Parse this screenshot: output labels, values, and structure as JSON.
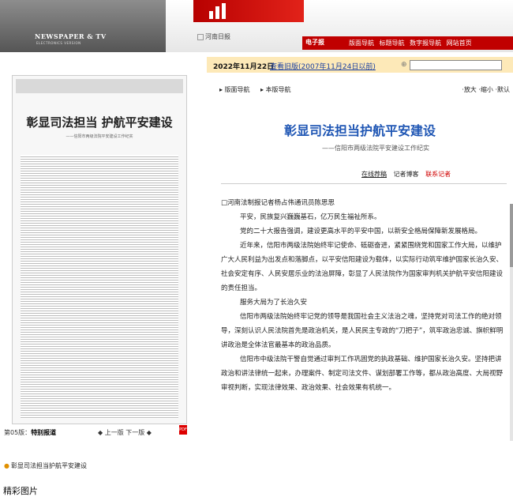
{
  "header": {
    "logo_title": "NEWSPAPER & TV",
    "logo_subtitle": "ELECTRONICS VERSION",
    "logo_alt": "河南日报",
    "nav_title": "电子报",
    "nav_items": [
      "版面导航",
      "标题导航",
      "数字报导航",
      "网站首页"
    ],
    "accent": "#c00000"
  },
  "left": {
    "thumbnail": {
      "headline": "彰显司法担当 护航平安建设",
      "subhead": "——信阳市两级法院平安建设工作纪实"
    },
    "edition_prefix": "第05版：",
    "edition_name": "特别报道",
    "prev_page": "上一版",
    "next_page": "下一版",
    "pdf_label": "PDF",
    "related_item": "彰显司法担当护航平安建设",
    "gallery_label": "精彩图片"
  },
  "right": {
    "date": "2022年11月22日",
    "prev_issue": "查看旧版(2007年11月24日以前)",
    "search_placeholder": "",
    "nav1": "版面导航",
    "nav2": "本版导航",
    "zoom": "放大",
    "shrink": "缩小",
    "zoom_sep": "·",
    "default": "默认",
    "title": "彰显司法担当护航平安建设",
    "subtitle": "——信阳市两级法院平安建设工作纪实",
    "actions": [
      "在线荐稿",
      "记者博客",
      "联系记者"
    ],
    "paragraphs": [
      "□河南法制报记者杨占伟通讯员陈思思",
      "平安，民族复兴巍巍基石，亿万民生福祉所系。",
      "党的二十大报告强调，建设更高水平的平安中国，以新安全格局保障新发展格局。",
      "近年来，信阳市两级法院始终牢记使命、砥砺奋进，紧紧围绕党和国家工作大局，以维护广大人民利益为出发点和落脚点，以平安信阳建设为载体，以实际行动筑牢维护国家长治久安、社会安定有序、人民安居乐业的法治屏障，彰显了人民法院作为国家审判机关护航平安信阳建设的责任担当。",
      "服务大局为了长治久安",
      "信阳市两级法院始终牢记党的领导是我国社会主义法治之魂，坚持党对司法工作的绝对领导，深刻认识人民法院首先是政治机关，是人民民主专政的“刀把子”，筑牢政治忠诚、旗帜鲜明讲政治是全体法官最基本的政治品质。",
      "信阳市中级法院干警自觉通过审判工作巩固党的执政基础、维护国家长治久安。坚持把讲政治和讲法律统一起来，办理案件、制定司法文件、谋划部署工作等，都从政治高度、大局视野审视判断，实现法律效果、政治效果、社会效果有机统一。"
    ]
  }
}
